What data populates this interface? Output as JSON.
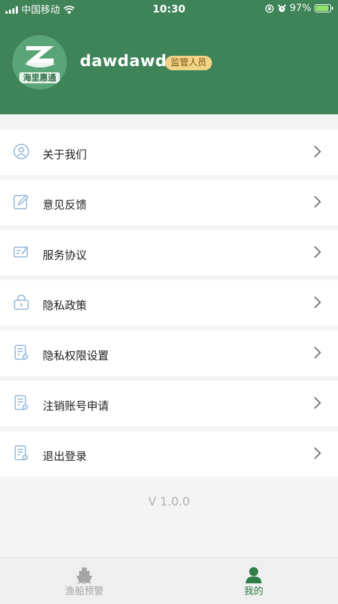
{
  "status_bar": {
    "carrier": "中国移动",
    "time": "10:30",
    "battery": "97%",
    "battery_level": 0.97
  },
  "profile": {
    "username": "dawdawd",
    "role_badge": "监管人员",
    "avatar_logo_text": "海里惠通"
  },
  "menu": {
    "items": [
      {
        "label": "关于我们",
        "icon": "person-icon"
      },
      {
        "label": "意见反馈",
        "icon": "edit-icon"
      },
      {
        "label": "服务协议",
        "icon": "agreement-icon"
      },
      {
        "label": "隐私政策",
        "icon": "lock-icon"
      },
      {
        "label": "隐私权限设置",
        "icon": "document-icon"
      },
      {
        "label": "注销账号申请",
        "icon": "document-icon"
      },
      {
        "label": "退出登录",
        "icon": "document-icon"
      }
    ]
  },
  "version": "V 1.0.0",
  "tabbar": {
    "tabs": [
      {
        "label": "渔船预警",
        "icon": "ship-icon",
        "active": false
      },
      {
        "label": "我的",
        "icon": "user-icon",
        "active": true
      }
    ]
  },
  "colors": {
    "brand_green": "#3f8358",
    "active_tab": "#2f7d49",
    "badge_bg": "#f2d488",
    "icon_blue": "#8fb3d6"
  }
}
